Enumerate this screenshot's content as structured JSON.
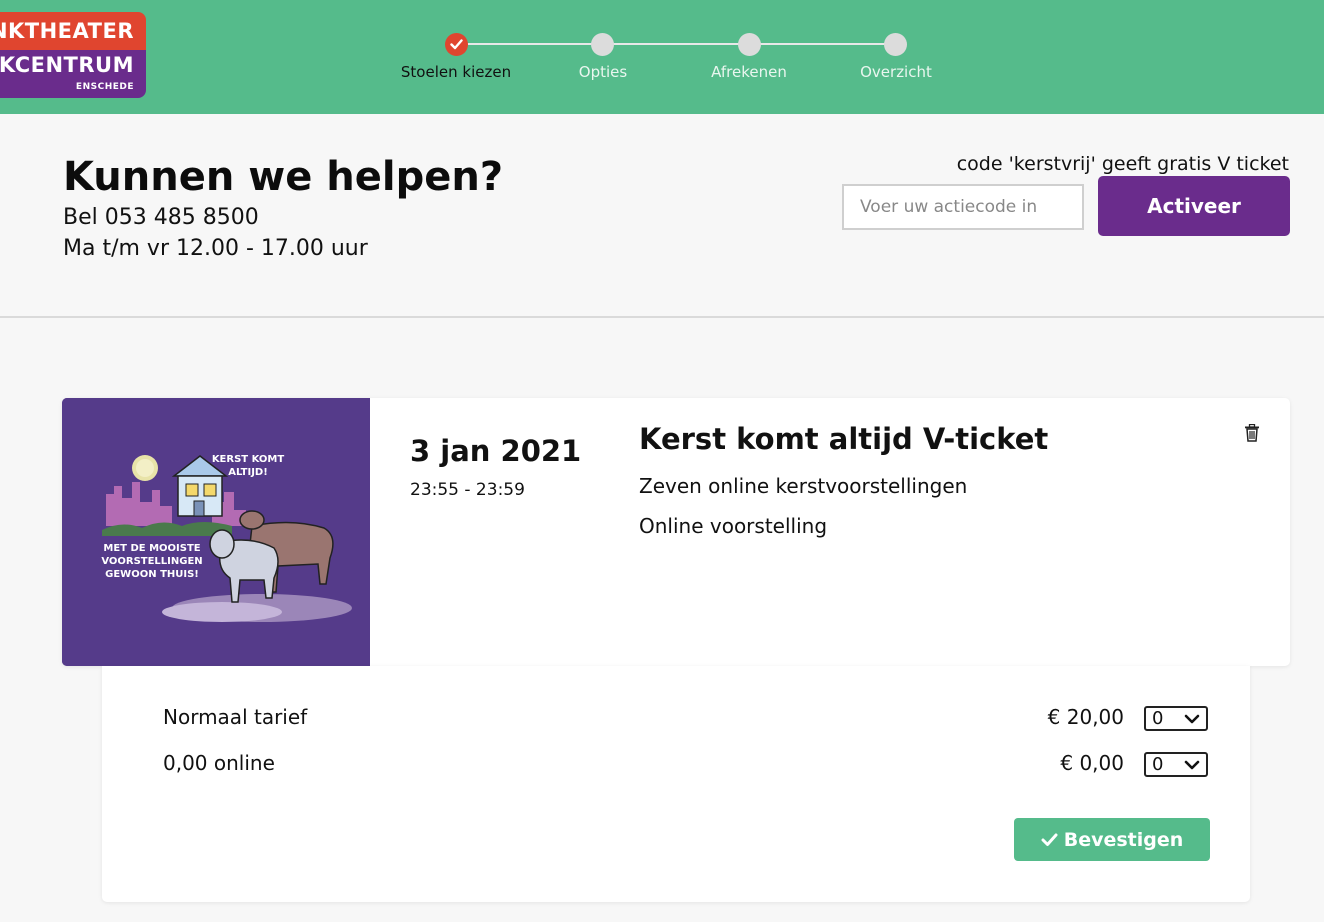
{
  "header": {
    "logo": {
      "line1": "NKTHEATER",
      "line2": "KCENTRUM",
      "line3": "ENSCHEDE"
    },
    "steps": [
      {
        "label": "Stoelen kiezen",
        "state": "done"
      },
      {
        "label": "Opties",
        "state": "pending"
      },
      {
        "label": "Afrekenen",
        "state": "pending"
      },
      {
        "label": "Overzicht",
        "state": "pending"
      }
    ],
    "colors": {
      "bar": "#55bb8b",
      "done": "#e0452f",
      "pending": "#dcdcdc"
    }
  },
  "help": {
    "title": "Kunnen we helpen?",
    "phone": "Bel 053 485 8500",
    "hours": "Ma t/m vr 12.00 - 17.00 uur"
  },
  "promo": {
    "hint": "code 'kerstvrij' geeft gratis V ticket",
    "placeholder": "Voer uw actiecode in",
    "button_label": "Activeer",
    "button_color": "#6a2c8c"
  },
  "event": {
    "date": "3 jan 2021",
    "time": "23:55 - 23:59",
    "title": "Kerst komt altijd V-ticket",
    "subtitle": "Zeven online kerstvoorstellingen",
    "type": "Online voorstelling",
    "image_text": {
      "bubble1": "KERST KOMT ALTIJD!",
      "bubble2": "MET DE MOOISTE VOORSTELLINGEN GEWOON THUIS!"
    },
    "delete_icon": "trash-icon"
  },
  "tariffs": [
    {
      "label": "Normaal tarief",
      "price": "€ 20,00",
      "qty": "0"
    },
    {
      "label": "0,00 online",
      "price": "€ 0,00",
      "qty": "0"
    }
  ],
  "confirm": {
    "label": "Bevestigen",
    "icon": "check-icon"
  }
}
